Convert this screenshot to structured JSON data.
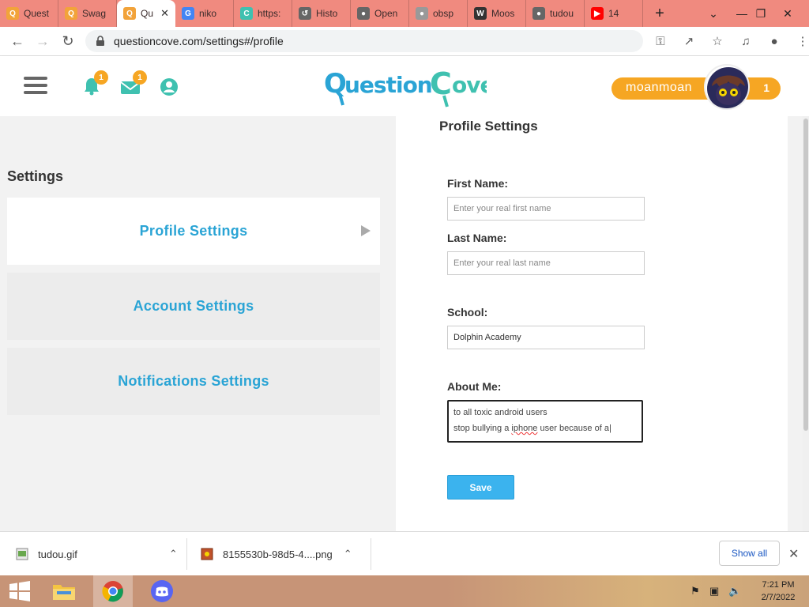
{
  "browser": {
    "tabs": [
      {
        "label": "Quest",
        "fav": "Q",
        "color": "#f2a33a"
      },
      {
        "label": "Swag",
        "fav": "Q",
        "color": "#f2a33a"
      },
      {
        "label": "Qu",
        "fav": "Q",
        "color": "#f2a33a",
        "active": true
      },
      {
        "label": "niko",
        "fav": "G",
        "color": "#4285f4"
      },
      {
        "label": "https:",
        "fav": "C",
        "color": "#3fc1b0"
      },
      {
        "label": "Histo",
        "fav": "↺",
        "color": "#666"
      },
      {
        "label": "Open",
        "fav": "●",
        "color": "#666"
      },
      {
        "label": "obsp",
        "fav": "●",
        "color": "#999"
      },
      {
        "label": "Moos",
        "fav": "W",
        "color": "#333"
      },
      {
        "label": "tudou",
        "fav": "●",
        "color": "#666"
      },
      {
        "label": "14",
        "fav": "▶",
        "color": "#f00"
      }
    ],
    "url": "questioncove.com/settings#/profile"
  },
  "header": {
    "logo": "QuestionCove",
    "notification_count": "1",
    "message_count": "1",
    "username": "moanmoan",
    "user_score": "1"
  },
  "sidebar": {
    "title": "Settings",
    "items": [
      {
        "label": "Profile Settings"
      },
      {
        "label": "Account Settings"
      },
      {
        "label": "Notifications Settings"
      }
    ]
  },
  "profile": {
    "title": "Profile Settings",
    "first_name_label": "First Name:",
    "first_name_placeholder": "Enter your real first name",
    "last_name_label": "Last Name:",
    "last_name_placeholder": "Enter your real last name",
    "school_label": "School:",
    "school_value": "Dolphin Academy",
    "about_label": "About Me:",
    "about_line1": "to all toxic android users",
    "about_line2_a": "stop bullying a ",
    "about_line2_b": "iphone",
    "about_line2_c": " user because of a",
    "save_label": "Save"
  },
  "downloads": {
    "item1": "tudou.gif",
    "item2": "8155530b-98d5-4....png",
    "show_all": "Show all"
  },
  "taskbar": {
    "time": "7:21 PM",
    "date": "2/7/2022"
  },
  "colors": {
    "accent": "#2aa4d5",
    "orange": "#f6a623",
    "tabbar": "#f08a7f"
  }
}
